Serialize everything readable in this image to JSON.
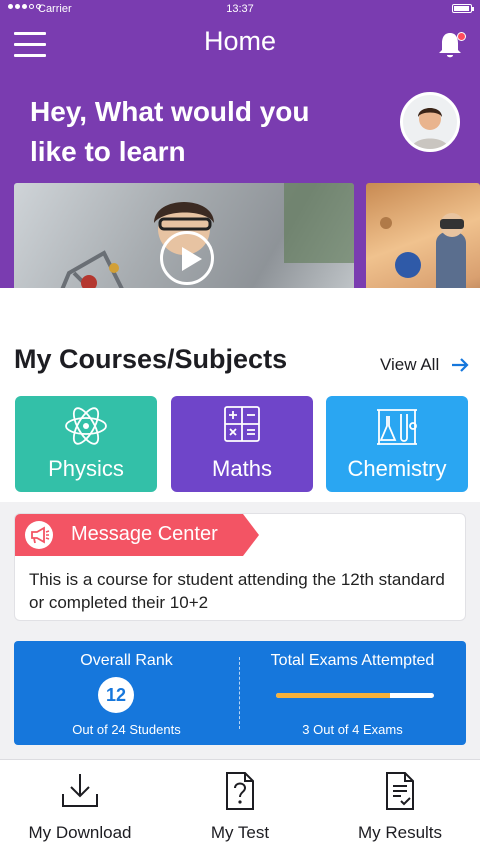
{
  "status_bar": {
    "carrier": "Carrier",
    "time": "13:37"
  },
  "header": {
    "title": "Home",
    "greeting": "Hey, What would you like to learn"
  },
  "icons": {
    "menu": "menu-icon",
    "bell": "bell-icon",
    "play": "play-icon",
    "physics": "atom-icon",
    "maths": "calculator-icon",
    "chemistry": "lab-flask-icon",
    "message": "megaphone-icon",
    "download": "download-icon",
    "test": "question-document-icon",
    "results": "checklist-document-icon"
  },
  "courses": {
    "title": "My Courses/Subjects",
    "view_all": "View All",
    "items": [
      {
        "label": "Physics",
        "color": "#33c0a8"
      },
      {
        "label": "Maths",
        "color": "#6f45c9"
      },
      {
        "label": "Chemistry",
        "color": "#2aa6f2"
      }
    ]
  },
  "message_center": {
    "title": "Message Center",
    "text": "This is a course for student attending the 12th standard or completed their 10+2"
  },
  "stats": {
    "rank_title": "Overall Rank",
    "rank_value": "12",
    "rank_sub": "Out of 24 Students",
    "exams_title": "Total Exams Attempted",
    "exams_progress": 0.72,
    "exams_sub": "3 Out of 4 Exams"
  },
  "tabs": [
    {
      "label": "My Download"
    },
    {
      "label": "My Test"
    },
    {
      "label": "My Results"
    }
  ],
  "colors": {
    "primary": "#7a3cb0",
    "accent": "#1677dc",
    "alert": "#f35464",
    "progress": "#f6b13b"
  }
}
